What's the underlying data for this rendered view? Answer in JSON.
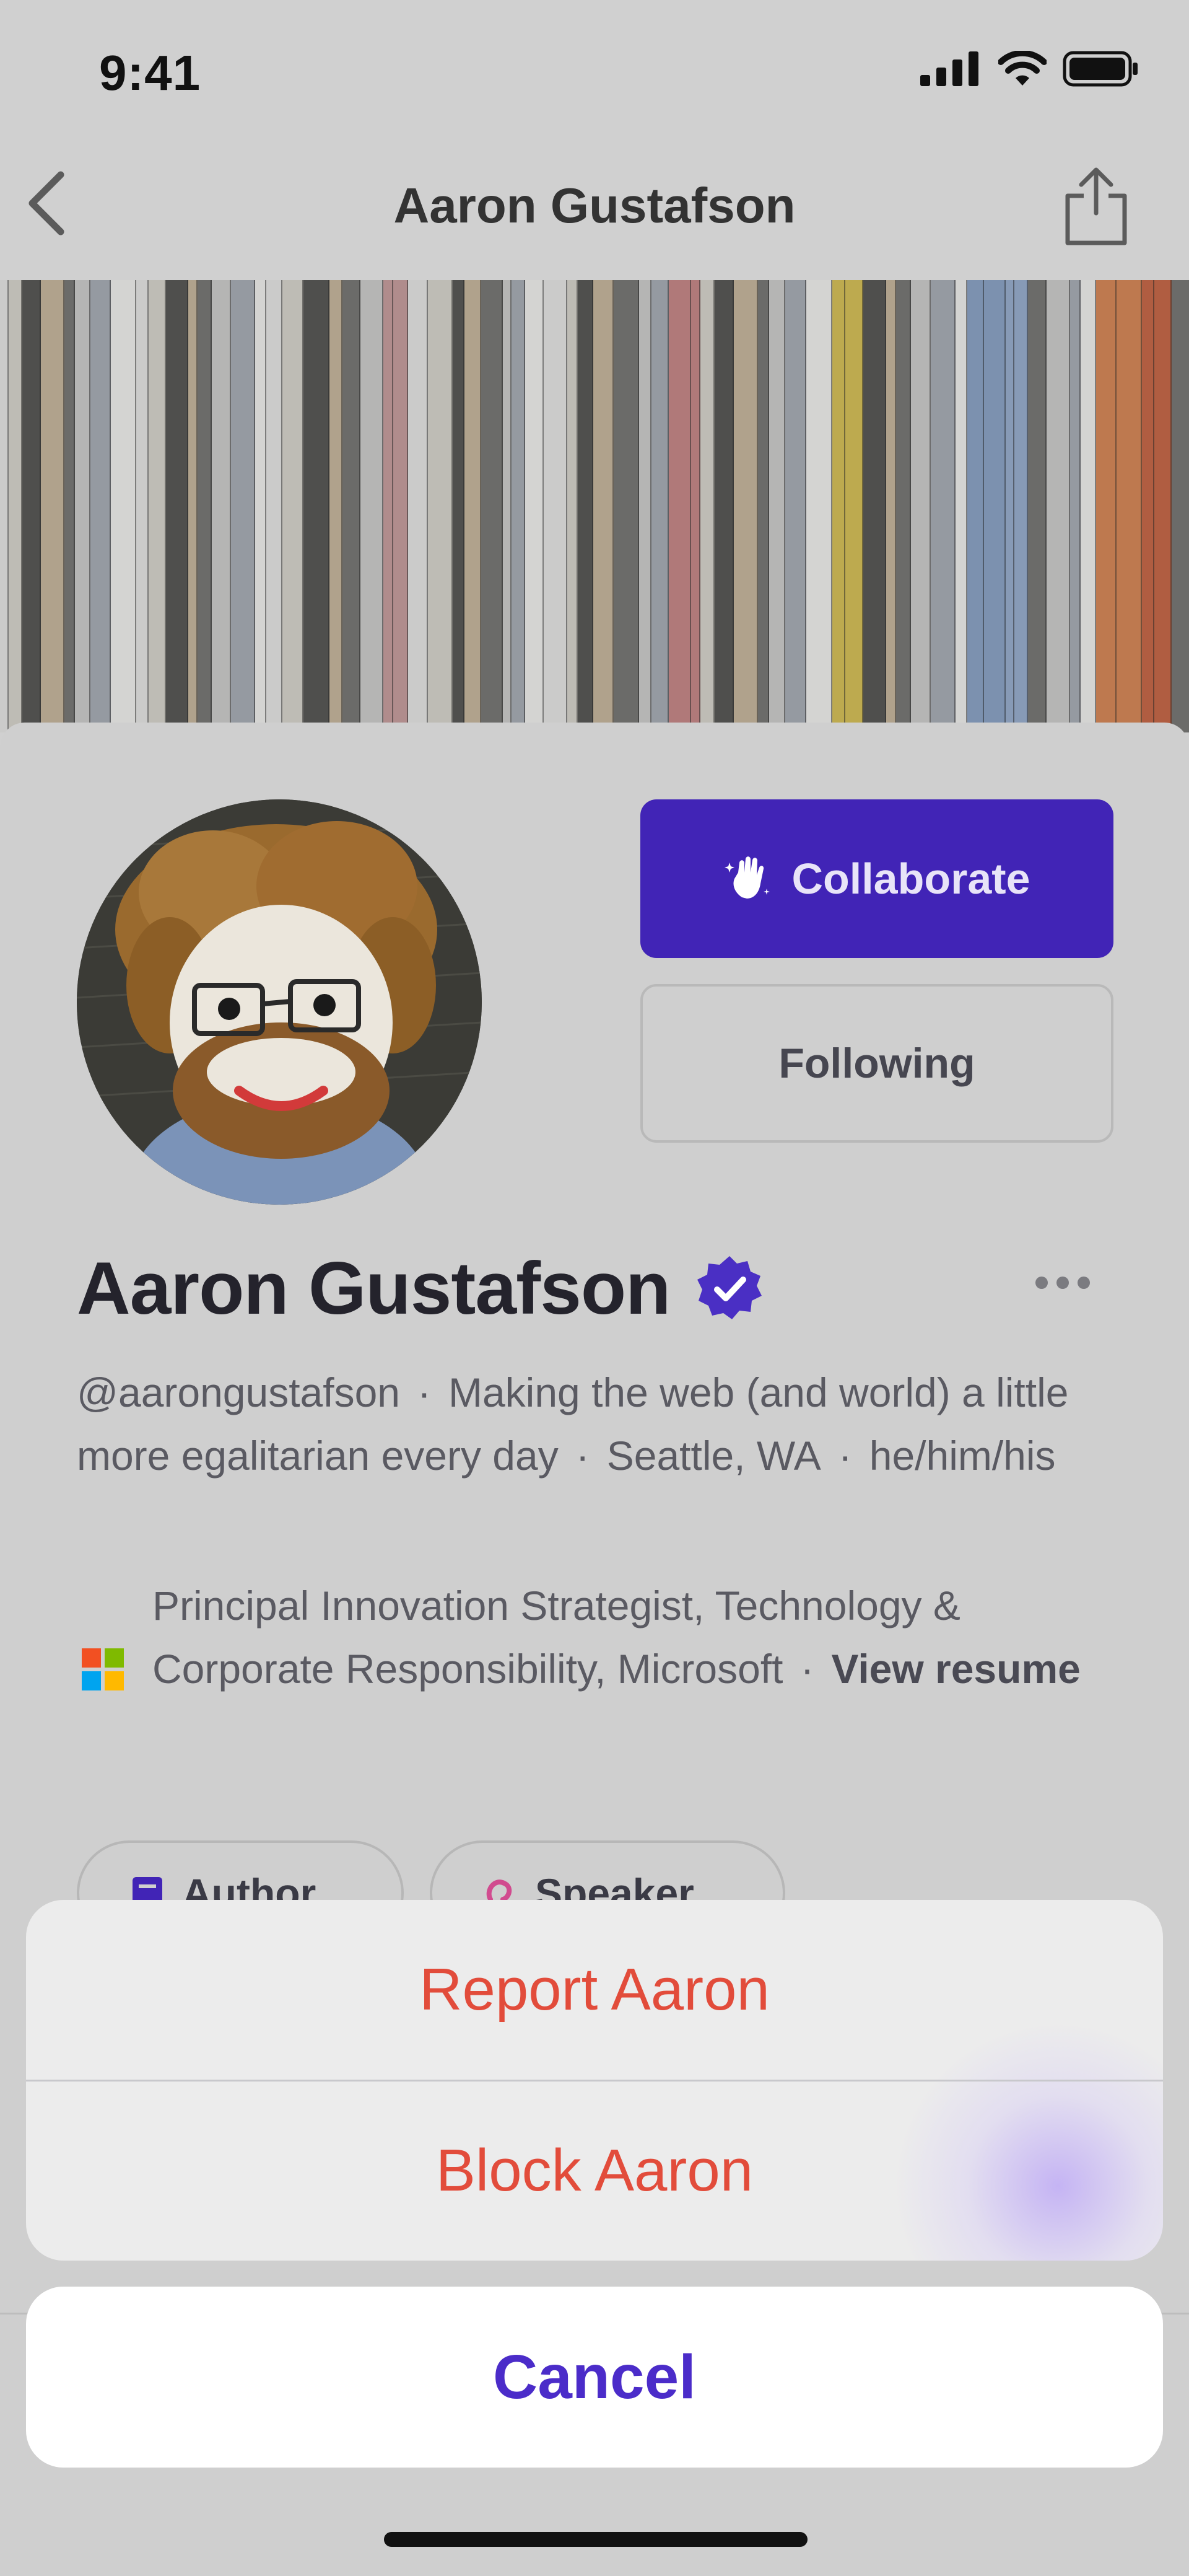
{
  "status_bar": {
    "time": "9:41"
  },
  "nav": {
    "title": "Aaron Gustafson"
  },
  "profile": {
    "name": "Aaron Gustafson",
    "verified": true,
    "collaborate_label": "Collaborate",
    "following_label": "Following",
    "handle": "@aarongustafson",
    "tagline": "Making the web (and world) a little more egalitarian every day",
    "location": "Seattle, WA",
    "pronouns": "he/him/his",
    "job_title": "Principal Innovation Strategist, Technology & Corporate Responsibility, Microsoft",
    "view_resume_label": "View resume",
    "separator": "·",
    "tags": [
      {
        "label": "Author"
      },
      {
        "label": "Speaker"
      }
    ]
  },
  "action_sheet": {
    "report_label": "Report Aaron",
    "block_label": "Block Aaron",
    "cancel_label": "Cancel"
  },
  "colors": {
    "accent": "#4124b6",
    "destructive": "#e24c3b",
    "cancel_text": "#4b2cc9",
    "verified_badge": "#4a2fc4",
    "page_background": "#d0d0d0",
    "sheet_background": "#ececec"
  },
  "icons": {
    "back": "chevron-left-icon",
    "share": "share-icon",
    "collaborate": "hand-sparkle-icon",
    "verified": "verified-badge-icon",
    "more": "more-horizontal-icon",
    "company": "microsoft-logo-icon"
  }
}
